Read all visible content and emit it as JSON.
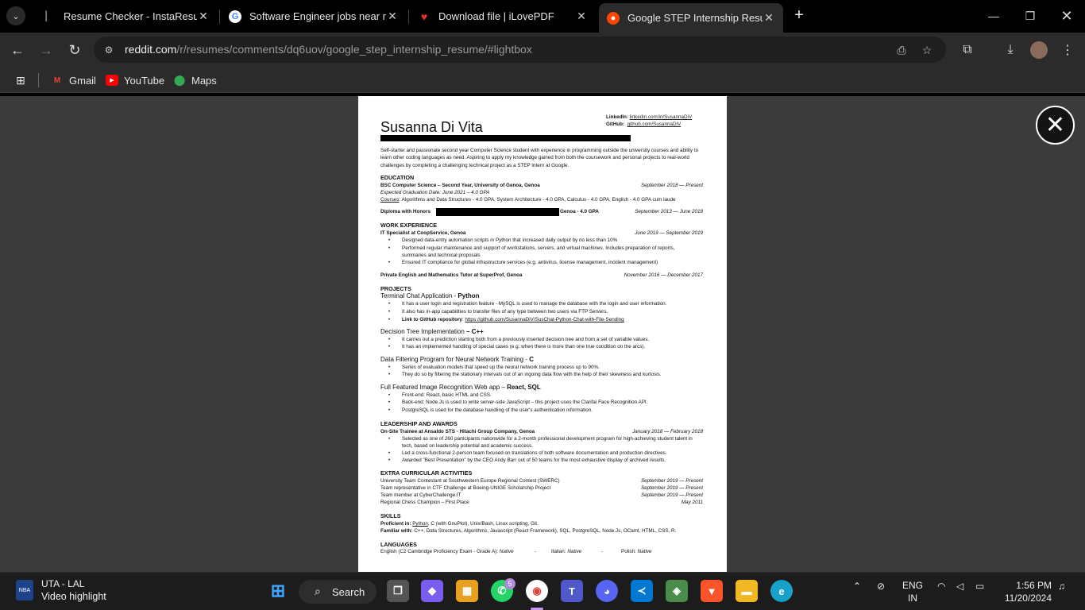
{
  "browser": {
    "tabs": [
      {
        "label": "Resume Checker - InstaResume",
        "icon": "instaresume-icon"
      },
      {
        "label": "Software Engineer jobs near me",
        "icon": "google-icon"
      },
      {
        "label": "Download file | iLovePDF",
        "icon": "ilovepdf-icon"
      },
      {
        "label": "Google STEP Internship Resume",
        "icon": "reddit-icon",
        "active": true
      }
    ],
    "url_host": "reddit.com",
    "url_path": "/r/resumes/comments/dq6uov/google_step_internship_resume/#lightbox",
    "bookmarks": [
      {
        "label": "Gmail",
        "icon": "gmail-icon"
      },
      {
        "label": "YouTube",
        "icon": "youtube-icon"
      },
      {
        "label": "Maps",
        "icon": "maps-icon"
      }
    ]
  },
  "resume": {
    "name": "Susanna Di Vita",
    "linkedin_label": "LinkedIn:",
    "linkedin": "linkedin.com/in/SusannaDiV",
    "github_label": "GitHub:",
    "github": "github.com/SusannaDiV",
    "summary": "Self-starter and passionate second year Computer Science student with experience in programming outside the university courses and ability to learn other coding languages as need. Aspiring to apply my knowledge gained from both the coursework and personal projects to real-world challenges by completing a challenging technical project as a STEP Intern at Google.",
    "education": {
      "heading": "EDUCATION",
      "degree": "BSC Computer Science – Second Year, University of Genoa, Genoa",
      "degree_dates": "September 2018 — Present",
      "expected": "Expected Graduation Date: June 2021 – 4.0 GPA",
      "courses_label": "Courses",
      "courses": ": Algorithms and Data Structures - 4.0 GPA, System Architecture - 4.0 GPA, Calculus - 4.0 GPA, English - 4.0 GPA cum laude",
      "diploma": "Diploma with Honors",
      "diploma_tail": "Genoa - 4.0 GPA",
      "diploma_dates": "September 2013 — June 2018"
    },
    "work": {
      "heading": "WORK EXPERIENCE",
      "job1": "IT Specialist at CoopService, Genoa",
      "job1_dates": "June 2019 — September 2019",
      "job1_bullets": [
        "Designed data-entry automation scripts in Python that increased daily output by no less than 10%",
        "Performed regular maintenance and support of workstations, servers, and virtual machines. Includes preparation of reports, summaries and technical proposals",
        "Ensured IT compliance for global infrastructure services (e.g. antivirus, license management, incident management)"
      ],
      "job2": "Private English and Mathematics Tutor at SuperProf, Genoa",
      "job2_dates": "November 2016 — December 2017"
    },
    "projects": {
      "heading": "PROJECTS",
      "p1_title": "Terminal Chat Application - ",
      "p1_tech": "Python",
      "p1_bullets": [
        "It has a user login and registration feature - MySQL is used to manage the database with the login and user information.",
        "It also has in-app capabilities to transfer files of any type between two users via FTP Servers."
      ],
      "p1_link_label": "Link to GitHub repository",
      "p1_link": "https://github.com/SusannaDiV/SusChat-Python-Chat-with-File-Sending",
      "p2_title": "Decision Tree Implementation ",
      "p2_tech": "– C++",
      "p2_bullets": [
        "It carries out a prediction starting both from a previously inserted decision tree and from a set of variable values.",
        "It has an implemented handling of special cases (e.g. when there is more than one true condition on the arcs)."
      ],
      "p3_title": "Data Filtering Program for Neural Network Training - ",
      "p3_tech": "C",
      "p3_bullets": [
        "Series of evaluation models that speed up the neural network training process up to 90%.",
        "They do so by filtering the stationary intervals out of an ingoing data flow with the help of their skewness and kurtosis."
      ],
      "p4_title": "Full Featured Image Recognition Web app – ",
      "p4_tech": "React, SQL",
      "p4_bullets": [
        "Front-end: React, basic HTML and CSS.",
        "Back-end: Node.Js is used to write server-side JavaScript – this project uses the Clarifai Face Recognition API.",
        "PostgreSQL is used for the database handling of the user's authentication information."
      ]
    },
    "leadership": {
      "heading": "LEADERSHIP AND AWARDS",
      "title": "On-Site Trainee at Ansaldo STS - Hitachi Group Company, Genoa",
      "dates": "January 2018 — February 2018",
      "bullets": [
        "Selected as one of 260 participants nationwide for a 2-month professional development program for high-achieving student talent in tech, based on leadership potential and academic success.",
        "Led a cross-functional 2-person team focused on translations of both software documentation and production directives.",
        "Awarded \"Best Presentation\" by the CEO Andy Barr out of 50 teams for the most exhaustive display of archived results."
      ]
    },
    "extra": {
      "heading": "EXTRA CURRICULAR ACTIVITIES",
      "rows": [
        {
          "text": "University Team Contestant at Southwestern Europe Regional Contest (SWERC)",
          "date": "September 2019 — Present"
        },
        {
          "text": "Team representative in CTF Challenge at Boeing-UNIGE Scholarship Project",
          "date": "September 2019 — Present"
        },
        {
          "text": "Team member at CyberChallenge.IT",
          "date": "September 2019 — Present"
        },
        {
          "text": "Regional Chess Champion – First Place",
          "date": "May 2011"
        }
      ]
    },
    "skills": {
      "heading": "SKILLS",
      "proficient_label": "Proficient in:",
      "proficient_link": "Python",
      "proficient": ", C (with GnuPlot), Unix/Bash, Linux scripting, Git.",
      "familiar_label": "Familiar with:",
      "familiar": "C++, Data Structures, Algorithms, Javascript (React Framework), SQL, PostgreSQL, Node.Js, OCaml, HTML, CSS, R."
    },
    "languages": {
      "heading": "LANGUAGES",
      "english": "English (C2 Cambridge Proficiency Exam - Grade A): ",
      "english_level": "Native",
      "italian": "Italian: ",
      "italian_level": "Native",
      "polish": "Polish: ",
      "polish_level": "Native",
      "sep": "-"
    }
  },
  "taskbar": {
    "news_title": "UTA - LAL",
    "news_sub": "Video highlight",
    "search": "Search",
    "whatsapp_badge": "5",
    "lang1": "ENG",
    "lang2": "IN",
    "time": "1:56 PM",
    "date": "11/20/2024"
  },
  "colors": {
    "page_bg": "#3b3b3b",
    "chrome_bg": "#2b2b2b",
    "taskbar_bg": "#1c1c1c"
  }
}
